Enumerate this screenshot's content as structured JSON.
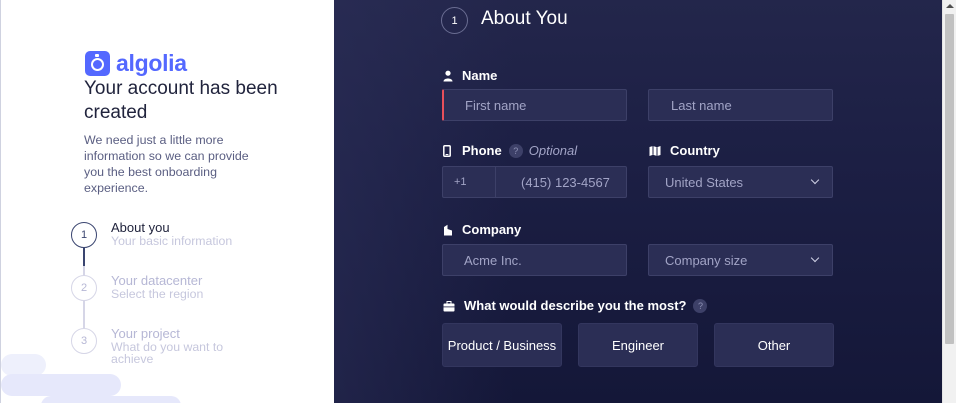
{
  "left": {
    "logo_text": "algolia",
    "title": "Your account has been created",
    "description": "We need just a little more information so we can provide you the best onboarding experience.",
    "steps": [
      {
        "num": "1",
        "title": "About you",
        "subtitle": "Your basic information",
        "active": true
      },
      {
        "num": "2",
        "title": "Your datacenter",
        "subtitle": "Select the region",
        "active": false
      },
      {
        "num": "3",
        "title": "Your project",
        "subtitle": "What do you want to achieve",
        "active": false
      }
    ]
  },
  "form": {
    "section_number": "1",
    "section_title": "About You",
    "name": {
      "label": "Name",
      "first_placeholder": "First name",
      "last_placeholder": "Last name"
    },
    "phone": {
      "label": "Phone",
      "help": "?",
      "optional": "Optional",
      "prefix": "+1",
      "placeholder": "(415) 123-4567"
    },
    "country": {
      "label": "Country",
      "selected": "United States"
    },
    "company": {
      "label": "Company",
      "placeholder": "Acme Inc.",
      "size_selected": "Company size"
    },
    "describe": {
      "label": "What would describe you the most?",
      "help": "?",
      "options": [
        "Product / Business",
        "Engineer",
        "Other"
      ]
    }
  },
  "colors": {
    "accent": "#5468ff",
    "panel": "#1c1f44",
    "field": "#2b2e55",
    "error": "#e8505b"
  }
}
